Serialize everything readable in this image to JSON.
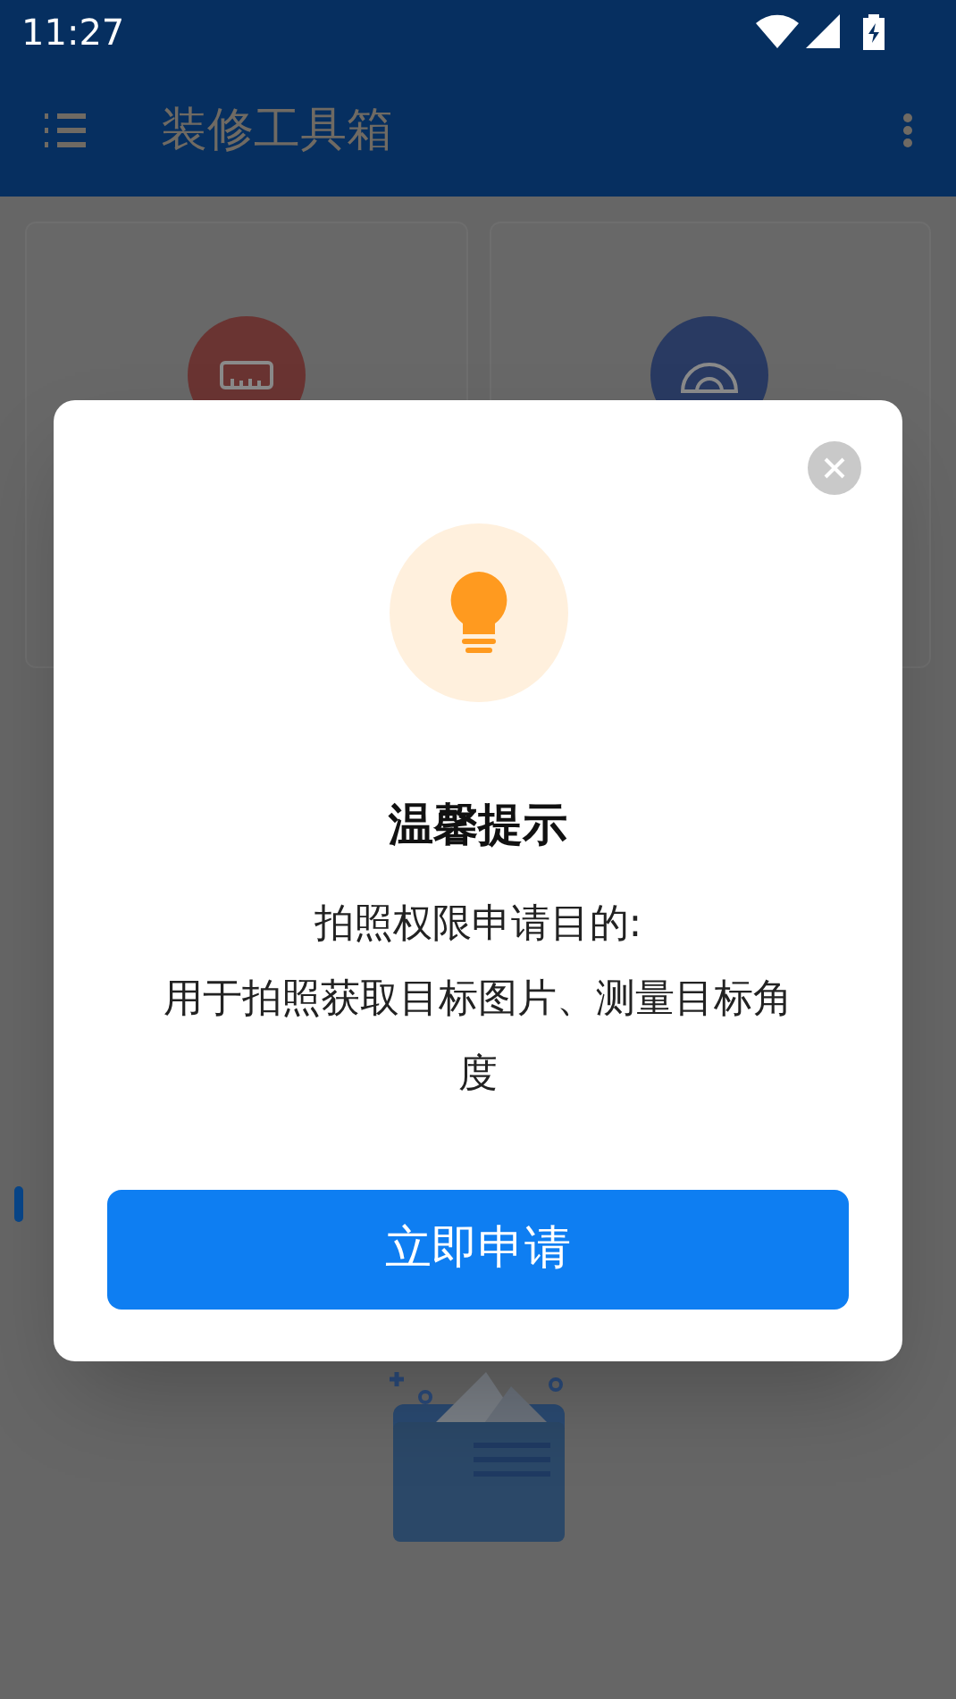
{
  "status_bar": {
    "time": "11:27"
  },
  "app_bar": {
    "title": "装修工具箱"
  },
  "tools": [
    {
      "kind": "ruler",
      "color": "#6a3432"
    },
    {
      "kind": "protractor",
      "color": "#293a62"
    }
  ],
  "dialog": {
    "title": "温馨提示",
    "lines": [
      "拍照权限申请目的:",
      "用于拍照获取目标图片、测量目标角度"
    ],
    "button": "立即申请"
  }
}
